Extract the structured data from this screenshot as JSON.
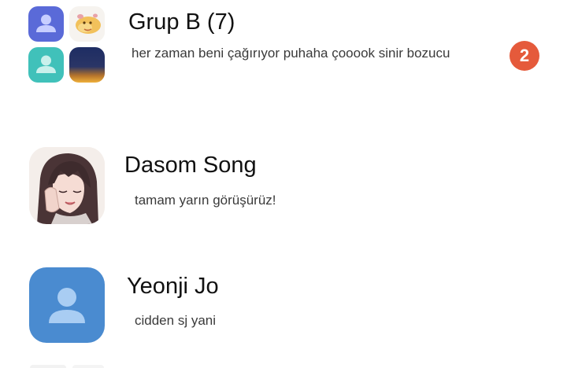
{
  "chats": [
    {
      "name": "Grup B (7)",
      "preview": "her zaman beni çağırıyor puhaha çooook sinir bozucu",
      "unread": "2"
    },
    {
      "name": "Dasom Song",
      "preview": "tamam yarın görüşürüz!"
    },
    {
      "name": "Yeonji Jo",
      "preview": "cidden sj yani"
    }
  ],
  "colors": {
    "accent_blue": "#4a8bd0",
    "accent_teal": "#3fbfb8",
    "accent_purple": "#5566d6",
    "badge_red": "#e55a3b"
  }
}
